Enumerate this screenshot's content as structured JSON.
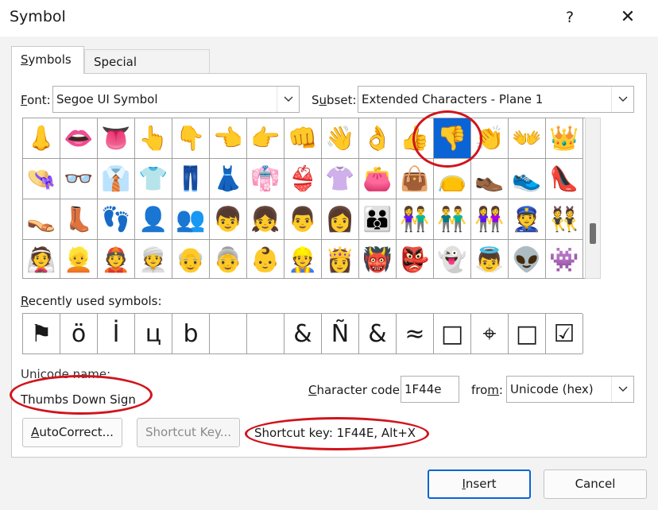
{
  "window": {
    "title": "Symbol",
    "help_glyph": "?",
    "close_glyph": "✕"
  },
  "tabs": [
    {
      "label": "Symbols",
      "mnemonic": "S",
      "rest": "ymbols",
      "active": true
    },
    {
      "label": "Special Characters",
      "active": false
    }
  ],
  "font": {
    "label_mn": "F",
    "label_rest": "ont:",
    "value": "Segoe UI Symbol"
  },
  "subset": {
    "label_pre": "S",
    "label_mn": "u",
    "label_rest": "bset:",
    "value": "Extended Characters - Plane 1"
  },
  "grid": {
    "rows": [
      [
        "👃",
        "👄",
        "👅",
        "👆",
        "👇",
        "👈",
        "👉",
        "👊",
        "👋",
        "👌",
        "👍",
        "👎",
        "👏",
        "👐",
        "👑"
      ],
      [
        "👒",
        "👓",
        "👔",
        "👕",
        "👖",
        "👗",
        "👘",
        "👙",
        "👚",
        "👛",
        "👜",
        "👝",
        "👞",
        "👟",
        "👠"
      ],
      [
        "👡",
        "👢",
        "👣",
        "👤",
        "👥",
        "👦",
        "👧",
        "👨",
        "👩",
        "👪",
        "👫",
        "👬",
        "👭",
        "👮",
        "👯"
      ],
      [
        "👰",
        "👱",
        "👲",
        "👳",
        "👴",
        "👵",
        "👶",
        "👷",
        "👸",
        "👹",
        "👺",
        "👻",
        "👼",
        "👽",
        "👾"
      ]
    ],
    "selected_row": 0,
    "selected_col": 11
  },
  "recent": {
    "label_mn": "R",
    "label_rest": "ecently used symbols:",
    "items": [
      "⚑",
      "ö",
      "İ",
      "ц",
      "b",
      "",
      "",
      "&",
      "Ñ",
      "&",
      "≈",
      "□",
      "⌖",
      "□",
      "☑"
    ]
  },
  "unicode": {
    "label": "Unicode name:",
    "value": "Thumbs Down Sign"
  },
  "charcode": {
    "label_mn": "C",
    "label_rest": "haracter code:",
    "value": "1F44e"
  },
  "from": {
    "label_pre": "fro",
    "label_mn": "m",
    "label_rest": ":",
    "value": "Unicode (hex)"
  },
  "buttons": {
    "autocorrect_mn": "A",
    "autocorrect_rest": "utoCorrect...",
    "shortcut_key": "Shortcut Key...",
    "insert_mn": "I",
    "insert_rest": "nsert",
    "cancel": "Cancel"
  },
  "shortcut_text": "Shortcut key: 1F44E, Alt+X",
  "colors": {
    "accent": "#0a64d6",
    "annotation": "#d0141c"
  }
}
